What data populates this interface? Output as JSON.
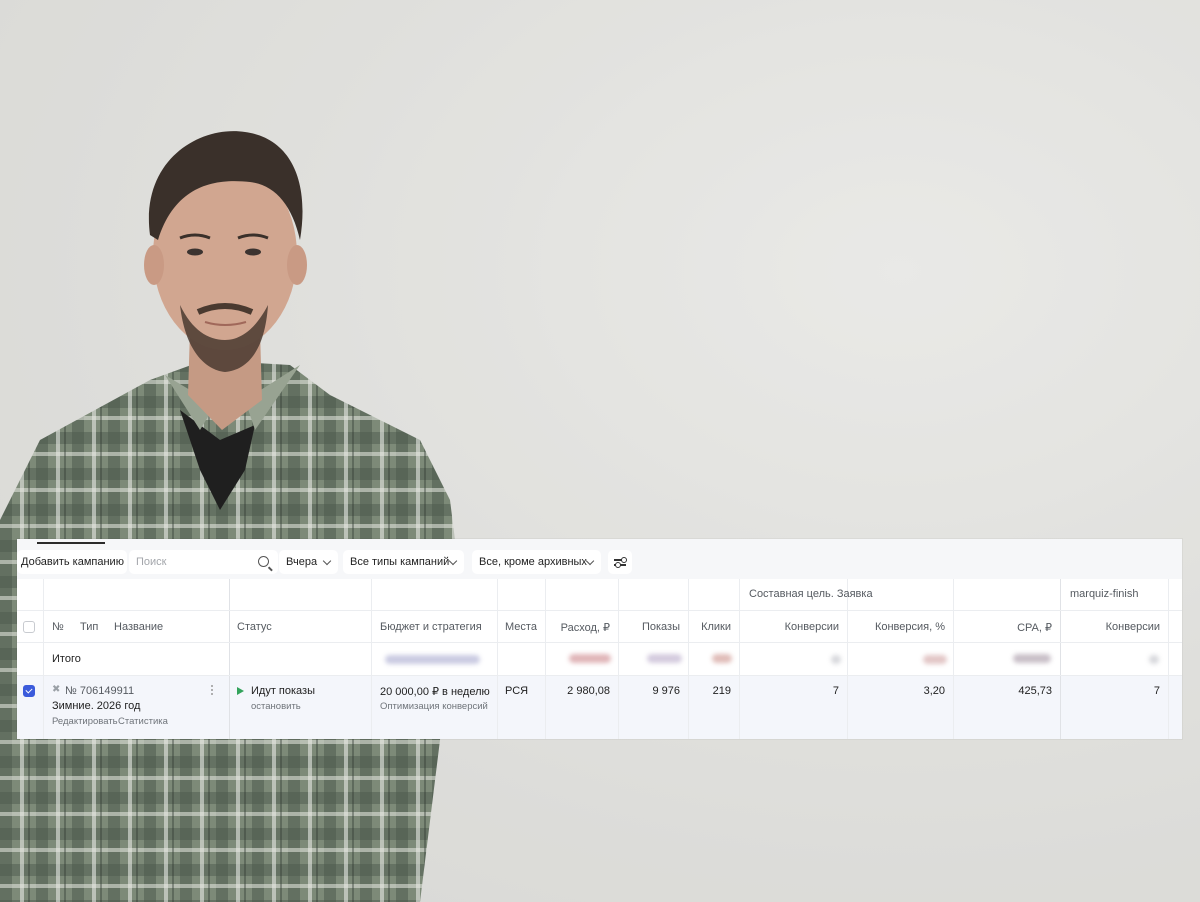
{
  "toolbar": {
    "add_campaign": "Добавить кампанию",
    "search_placeholder": "Поиск",
    "period": "Вчера",
    "campaign_types": "Все типы кампаний",
    "archive_filter": "Все, кроме архивных"
  },
  "table": {
    "group_headers": {
      "composite_goal": "Составная цель. Заявка",
      "marquiz": "marquiz-finish"
    },
    "columns": {
      "number": "№",
      "type": "Тип",
      "name": "Название",
      "status": "Статус",
      "budget": "Бюджет и стратегия",
      "places": "Места",
      "spend": "Расход, ₽",
      "impressions": "Показы",
      "clicks": "Клики",
      "conversions": "Конверсии",
      "conversion_rate": "Конверсия, %",
      "cpa": "CPA, ₽",
      "conversions_2": "Конверсии"
    },
    "total_row": {
      "label": "Итого"
    },
    "campaign": {
      "id": "№ 706149911",
      "name": "Зимние. 2026 год",
      "edit_link": "Редактировать",
      "stats_link": "Статистика",
      "status": "Идут показы",
      "stop_link": "остановить",
      "budget": "20 000,00 ₽ в неделю",
      "strategy": "Оптимизация конверсий",
      "places": "РСЯ",
      "spend": "2 980,08",
      "impressions": "9 976",
      "clicks": "219",
      "conversions": "7",
      "conversion_rate": "3,20",
      "cpa": "425,73",
      "conversions_2": "7"
    }
  },
  "colors": {
    "checkbox_accent": "#3b5bdb",
    "status_green": "#33a35b",
    "shirt": "#6f7d6a"
  }
}
